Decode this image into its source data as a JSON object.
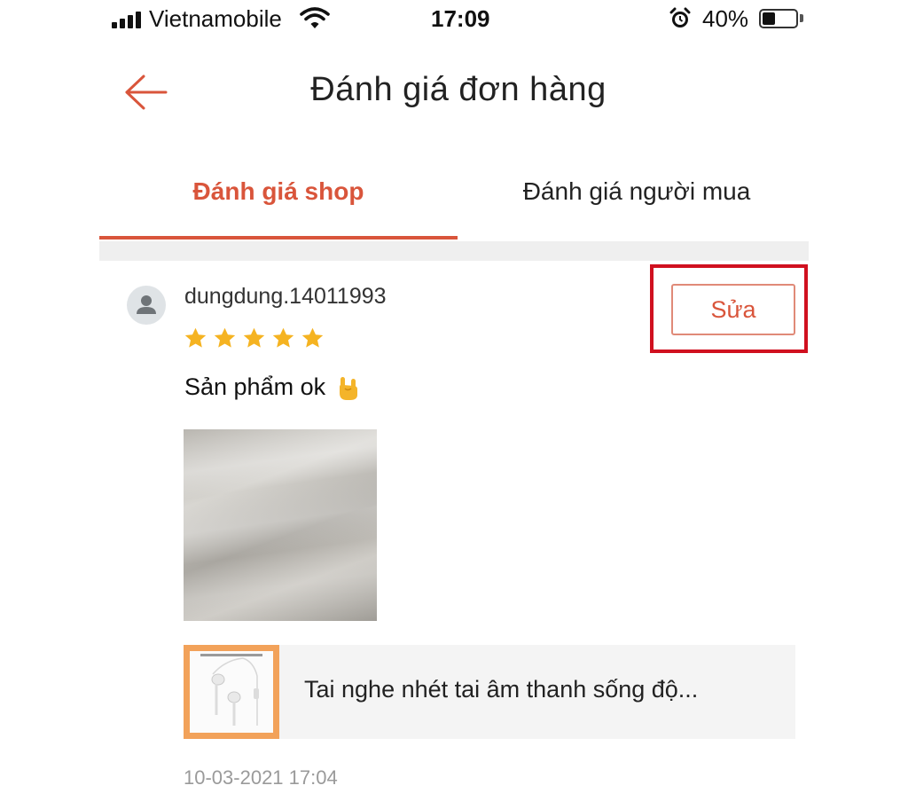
{
  "status_bar": {
    "carrier": "Vietnamobile",
    "time": "17:09",
    "battery_percent": "40%",
    "battery_level": 0.4,
    "icons": [
      "signal-icon",
      "wifi-icon",
      "alarm-icon",
      "battery-icon"
    ]
  },
  "header": {
    "title": "Đánh giá đơn hàng",
    "back_icon": "arrow-left-icon"
  },
  "tabs": [
    {
      "label": "Đánh giá shop",
      "active": true
    },
    {
      "label": "Đánh giá người mua",
      "active": false
    }
  ],
  "review": {
    "username": "dungdung.14011993",
    "rating": 5,
    "max_rating": 5,
    "text": "Sản phẩm ok",
    "emoji": "🤘",
    "edit_label": "Sửa",
    "product_name": "Tai nghe nhét tai âm thanh sống độ...",
    "timestamp": "10-03-2021 17:04"
  },
  "colors": {
    "accent": "#d9553b",
    "highlight_border": "#d0101f",
    "star": "#f5b321",
    "separator": "#efefef",
    "product_bg": "#f4f4f4",
    "thumb_border": "#f2a25a"
  }
}
